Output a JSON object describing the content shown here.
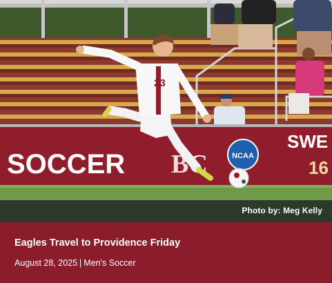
{
  "article": {
    "headline": "Eagles Travel to Providence Friday",
    "date": "August 28, 2025",
    "separator": "|",
    "category": "Men's Soccer",
    "photo_credit": "Photo by: Meg Kelly"
  },
  "photo": {
    "banner_text": "SOCCER",
    "banner_logo": "BC",
    "banner_right_text": "SWE",
    "banner_right_number": "16",
    "ncaa_logo_text": "NCAA",
    "jersey_number": "23"
  },
  "colors": {
    "info_background": "#8a1c2b",
    "credit_bar": "#2b3a2b",
    "banner_maroon": "#8f1d2c",
    "ncaa_blue": "#1f5fb0"
  }
}
